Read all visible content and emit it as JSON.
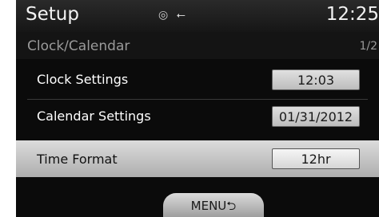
{
  "status_bar": {
    "title": "Setup",
    "icons": [
      "disc-icon",
      "usb-icon"
    ],
    "icon_glyphs": "◎ ⭠",
    "clock": "12:25"
  },
  "subheader": {
    "title": "Clock/Calendar",
    "page_indicator": "1/2"
  },
  "settings": [
    {
      "label": "Clock Settings",
      "value": "12:03"
    },
    {
      "label": "Calendar Settings",
      "value": "01/31/2012"
    },
    {
      "label": "Time Format",
      "value": "12hr",
      "highlighted": true
    }
  ],
  "menu_button": {
    "label": "MENU⮌"
  },
  "colors": {
    "background": "#0b0b0b",
    "highlight": "#c8c8c8",
    "text": "#ffffff"
  }
}
